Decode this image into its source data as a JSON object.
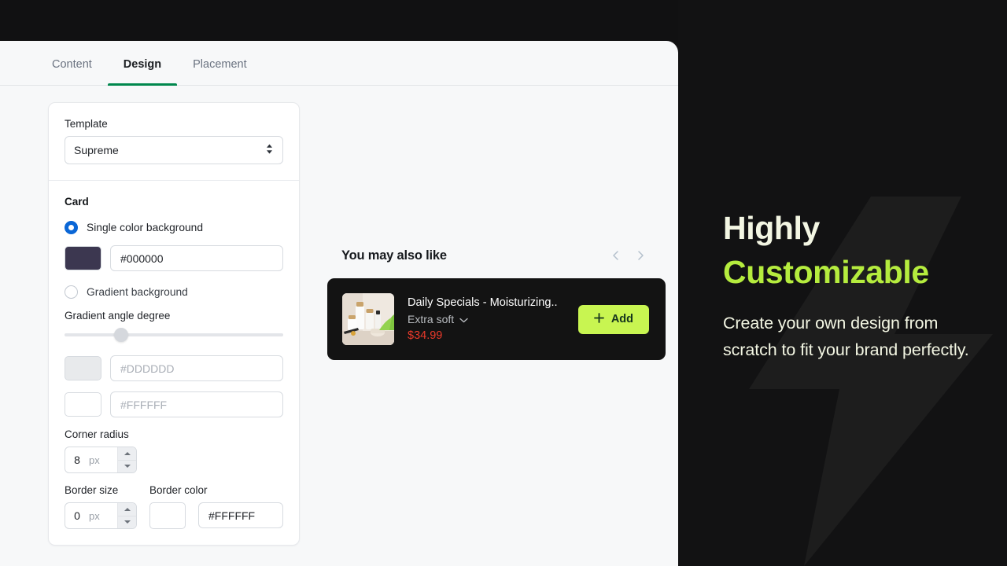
{
  "tabs": [
    {
      "label": "Content",
      "active": false
    },
    {
      "label": "Design",
      "active": true
    },
    {
      "label": "Placement",
      "active": false
    }
  ],
  "settings": {
    "template": {
      "label": "Template",
      "value": "Supreme"
    },
    "card": {
      "title": "Card",
      "single_color_option": "Single color background",
      "single_color_hex": "#000000",
      "single_color_swatch": "#3c3750",
      "gradient_option": "Gradient background",
      "gradient_angle_label": "Gradient angle degree",
      "gradient_angle_percent": 26,
      "gradient_color_1_placeholder": "#DDDDDD",
      "gradient_color_1_swatch": "#e8eaec",
      "gradient_color_2_placeholder": "#FFFFFF",
      "gradient_color_2_swatch": "#ffffff",
      "corner_radius_label": "Corner radius",
      "corner_radius_value": "8",
      "corner_radius_unit": "px",
      "border_size_label": "Border size",
      "border_size_value": "0",
      "border_size_unit": "px",
      "border_color_label": "Border color",
      "border_color_hex": "#FFFFFF",
      "border_color_swatch": "#ffffff"
    }
  },
  "preview": {
    "title": "You may also like",
    "product": {
      "name": "Daily Specials - Moisturizing..",
      "variant": "Extra soft",
      "price": "$34.99",
      "add_label": "Add"
    }
  },
  "promo": {
    "heading_line1": "Highly",
    "heading_line2": "Customizable",
    "body": "Create your own design from scratch to fit your brand perfectly.",
    "accent_color": "#b5ec3e",
    "text_color": "#f3f6e3"
  }
}
